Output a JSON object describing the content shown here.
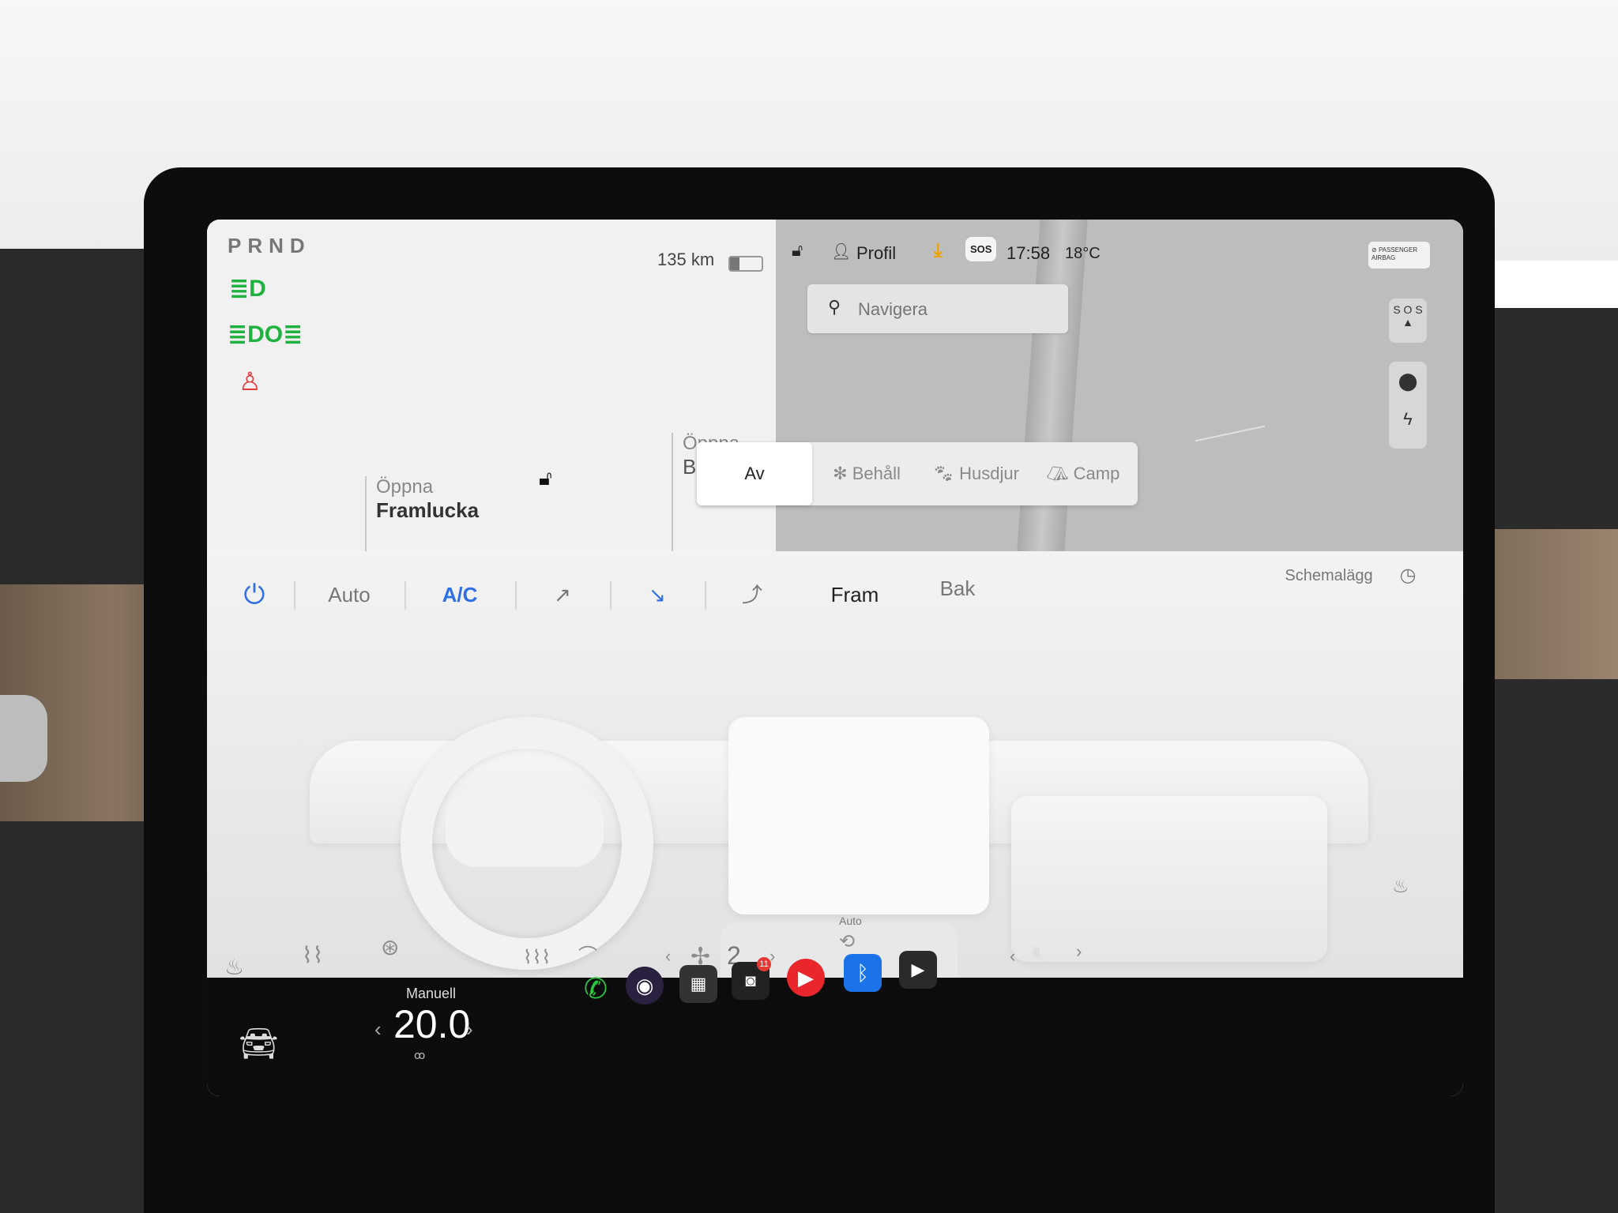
{
  "vehicle": {
    "gear_selector": "PRND",
    "range": "135 km",
    "battery_level": 0.3,
    "frunk": {
      "action": "Öppna",
      "name": "Framlucka"
    },
    "trunk": {
      "action": "Öppna",
      "name": "Ba"
    }
  },
  "status_bar": {
    "profile_label": "Profil",
    "sos_label": "SOS",
    "time": "17:58",
    "temperature": "18°C",
    "airbag_label": "PASSENGER AIRBAG"
  },
  "map": {
    "search_placeholder": "Navigera",
    "sos_button_label": "S O S"
  },
  "climate_keep_modes": [
    {
      "label": "Av",
      "active": true
    },
    {
      "label": "Behåll",
      "active": false
    },
    {
      "label": "Husdjur",
      "active": false
    },
    {
      "label": "Camp",
      "active": false
    }
  ],
  "climate": {
    "auto_label": "Auto",
    "ac_label": "A/C",
    "front_label": "Fram",
    "rear_label": "Bak",
    "schedule_label": "Schemalägg",
    "fan_speed": "2",
    "recirculation_auto_label": "Auto"
  },
  "taskbar": {
    "mode_label": "Manuell",
    "temperature_setting": "20.0",
    "camera_badge": "11"
  },
  "colors": {
    "accent_blue": "#2e6fe6",
    "light_green": "#1fb23f",
    "seatbelt_red": "#e23b3b",
    "phone_green": "#27c93f",
    "bluetooth_blue": "#1a73e8",
    "music_red": "#e8262b"
  }
}
